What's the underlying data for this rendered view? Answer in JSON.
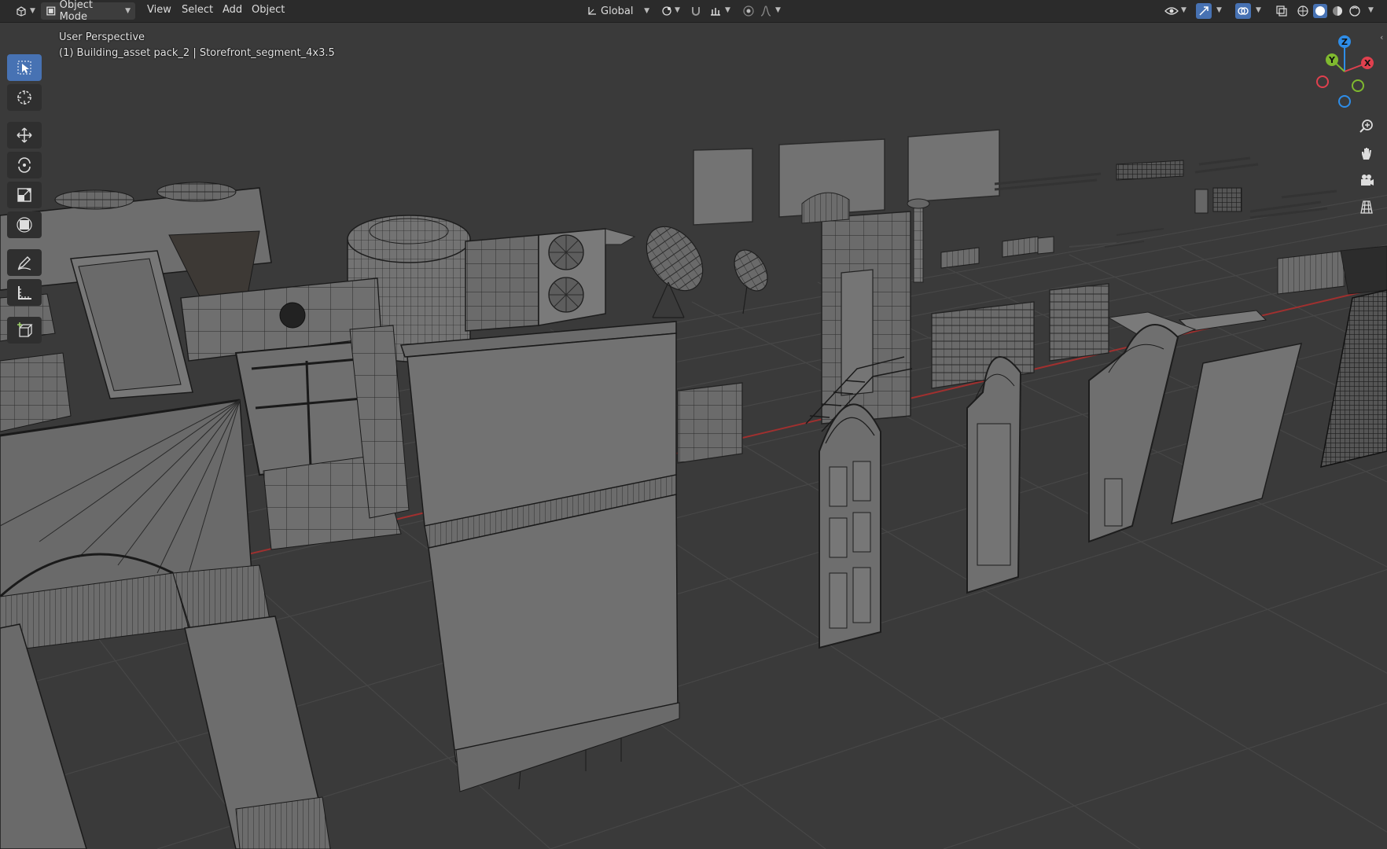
{
  "header": {
    "mode_label": "Object Mode",
    "menus": [
      "View",
      "Select",
      "Add",
      "Object"
    ],
    "orientation_label": "Global"
  },
  "viewport": {
    "view_name": "User Perspective",
    "active_object": "(1) Building_asset pack_2 | Storefront_segment_4x3.5"
  },
  "toolbar": {
    "tools": [
      "select-box",
      "cursor",
      "move",
      "rotate",
      "scale",
      "transform",
      "annotate",
      "measure",
      "add-cube"
    ],
    "active_tool": "select-box"
  },
  "navigation_gizmo": {
    "axes": [
      "X",
      "Y",
      "Z"
    ],
    "colors": {
      "x": "#e0404e",
      "y": "#7fb92f",
      "z": "#2e8de8"
    }
  },
  "shading": {
    "active": "solid"
  },
  "colors": {
    "accent": "#4772b3",
    "header_bg": "#2b2b2b",
    "viewport_bg": "#3a3a3a",
    "x_axis_line": "#a0302f"
  }
}
